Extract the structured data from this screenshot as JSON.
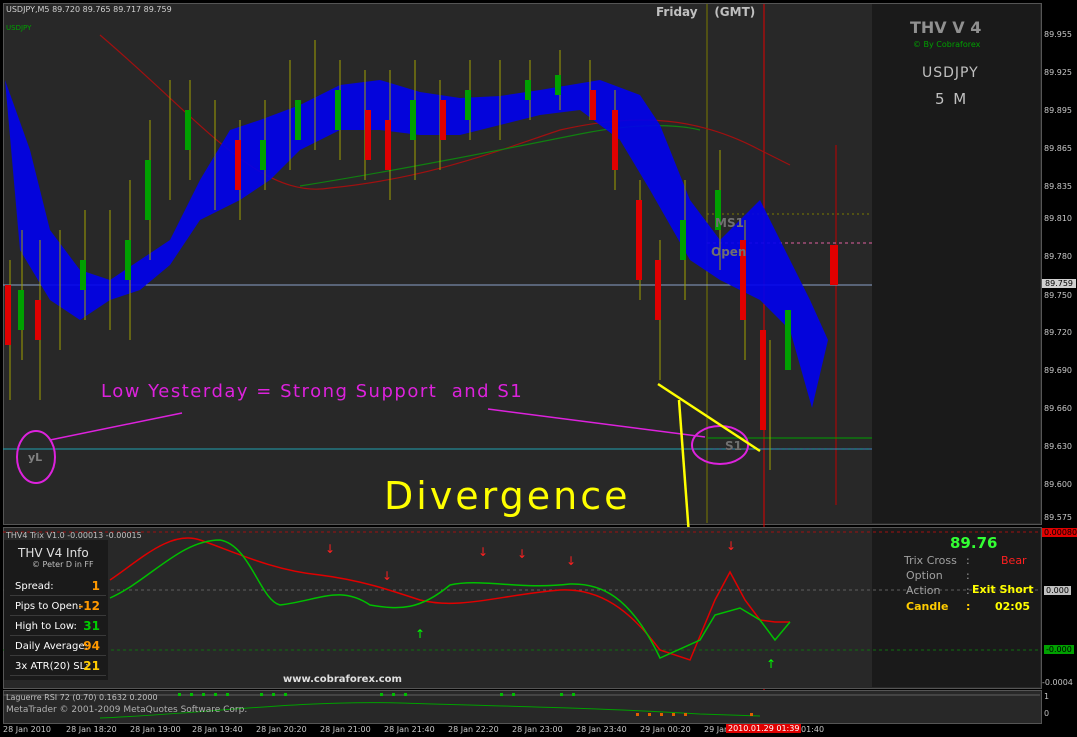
{
  "main_chart": {
    "header": "USDJPY,M5  89.720 89.765 89.717 89.759",
    "mini_label": "USDJPY",
    "session_label": "Friday    (GMT)",
    "current_price_label": "89.759",
    "brand": {
      "title": "THV V 4",
      "subtitle": "© By Cobraforex",
      "symbol": "USDJPY",
      "timeframe": "5 M"
    },
    "levels": {
      "ms1": "MS1",
      "open": "Open",
      "s1": "S1",
      "yl": "yL"
    },
    "price_labels": [
      "89.955",
      "89.925",
      "89.895",
      "89.865",
      "89.835",
      "89.810",
      "89.780",
      "89.750",
      "89.720",
      "89.690",
      "89.660",
      "89.630",
      "89.600",
      "89.575"
    ]
  },
  "annotations": {
    "support_note": "Low Yesterday = Strong Support  and S1",
    "divergence": "Divergence",
    "website": "www.cobraforex.com"
  },
  "trix_panel": {
    "header": "THV4 Trix V1.0 -0.00013 -0.00015",
    "price_labels": {
      "top": "0.00080",
      "zero": "0.000",
      "neg": "-0.000",
      "bottom": "-0.0004"
    }
  },
  "info_box": {
    "title": "THV  V4  Info",
    "credit": "© Peter D  in FF",
    "rows": [
      {
        "label": "Spread:",
        "value": "1",
        "color": "#ff9900"
      },
      {
        "label": "Pips to Open:",
        "value": "-12",
        "color": "#ff9900"
      },
      {
        "label": "High to Low:",
        "value": "31",
        "color": "#00cc00"
      },
      {
        "label": "Daily Average:",
        "value": "94",
        "color": "#ff9900"
      },
      {
        "label": "3x ATR(20) SL:",
        "value": "21",
        "color": "#ffcc00"
      }
    ]
  },
  "signal_panel": {
    "price": "89.76",
    "trix_cross": {
      "label": "Trix Cross",
      "sep": ":",
      "value": "Bear"
    },
    "option": {
      "label": "Option",
      "sep": ":"
    },
    "action": {
      "label": "Action",
      "sep": ":",
      "value": "Exit Short"
    },
    "candle": {
      "label": "Candle",
      "sep": ":",
      "value": "02:05"
    }
  },
  "rsi_panel": {
    "header": "Laguerre RSI 72 (0.70) 0.1632 0.2000",
    "copyright": "MetaTrader © 2001-2009 MetaQuotes Software Corp.",
    "labels": {
      "top": "1",
      "bottom": "0"
    }
  },
  "time_axis": {
    "labels": [
      "28 Jan 2010",
      "28 Jan 18:20",
      "28 Jan 19:00",
      "28 Jan 19:40",
      "28 Jan 20:20",
      "28 Jan 21:00",
      "28 Jan 21:40",
      "28 Jan 22:20",
      "28 Jan 23:00",
      "28 Jan 23:40",
      "29 Jan 00:20",
      "29 Jan 01:00",
      "01:40"
    ],
    "current_time": "2010.01.29 01:39"
  },
  "colors": {
    "bull": "#00a000",
    "bear": "#e00000",
    "cloud": "#0000ff",
    "accent": "#ffff00",
    "annotation": "#dd22dd"
  }
}
